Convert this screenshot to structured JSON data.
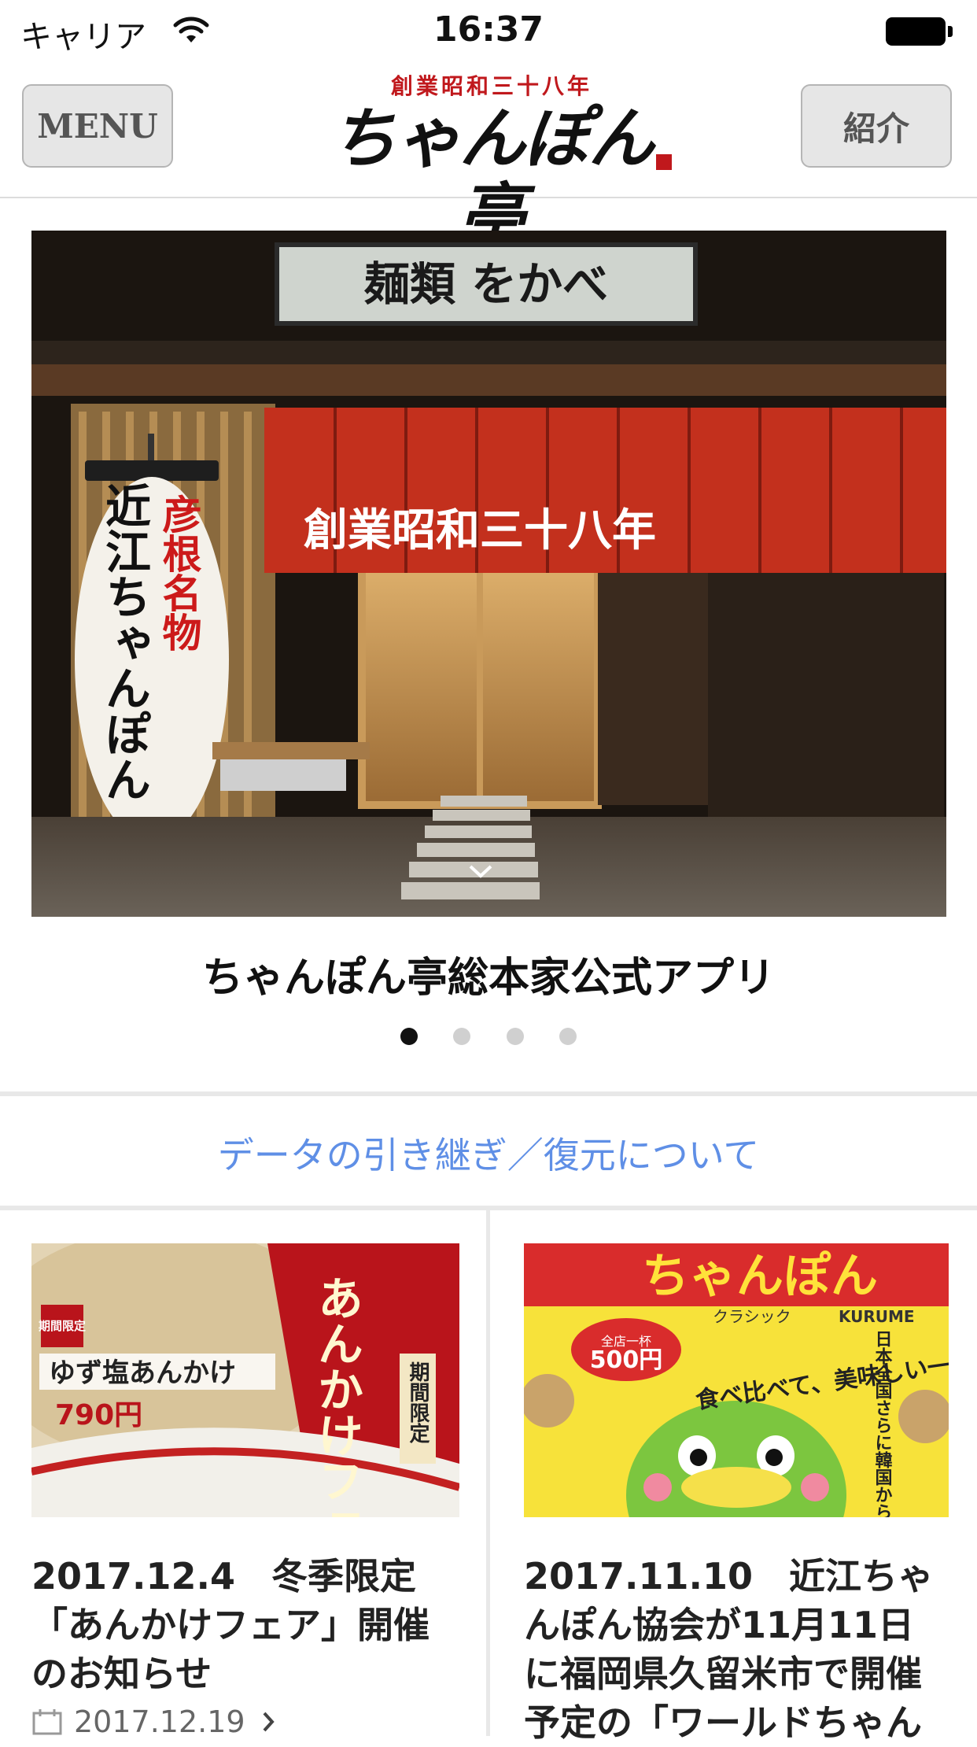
{
  "status_bar": {
    "carrier": "キャリア",
    "time": "16:37"
  },
  "nav": {
    "menu_label": "MENU",
    "intro_label": "紹介",
    "logo_sub": "創業昭和三十八年",
    "logo_main": "ちゃんぽん亭"
  },
  "hero": {
    "signboard": "麺類 をかべ",
    "noren_text": "創業昭和三十八年",
    "lantern_text": "彦根名物 近江ちゃんぽん",
    "caption": "ちゃんぽん亭総本家公式アプリ",
    "slide_count": 4,
    "active_slide": 0
  },
  "data_link": "データの引き継ぎ／復元について",
  "news": [
    {
      "title": "2017.12.4　冬季限定「あんかけフェア」開催のお知らせ",
      "date": "2017.12.19",
      "thumb": {
        "small_tag": "期間限定",
        "dish": "ゆず塩あんかけ",
        "price": "790円",
        "fair": "あんかけフェア",
        "note": "期間限定"
      }
    },
    {
      "title": "2017.11.10　近江ちゃんぽん協会が11月11日に福岡県久留米市で開催予定の「ワールドちゃん",
      "thumb": {
        "headline": "ちゃんぽん",
        "sub": "クラシック",
        "place": "KURUME",
        "price": "500円",
        "price_label": "全店一杯",
        "slogan": "食べ比べて、美味しい一杯",
        "side": "日本全国さらに韓国からご当地ちゃんぽん"
      }
    }
  ],
  "colors": {
    "link": "#5f8fe6",
    "brand_red": "#c0181c",
    "separator": "#e8e8e8"
  }
}
